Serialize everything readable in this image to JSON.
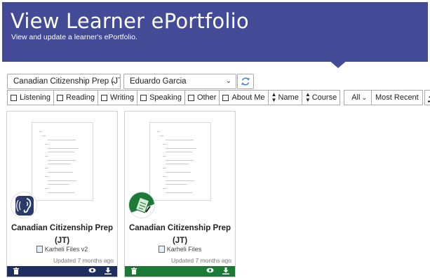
{
  "header": {
    "title": "View Learner ePortfolio",
    "subtitle": "View and update a learner's ePortfolio.",
    "bg_color": "#434b96"
  },
  "selectors": {
    "course": "Canadian Citizenship Prep (JT",
    "learner": "Eduardo Garcia",
    "refresh_icon": "refresh-icon"
  },
  "filters": {
    "skills": [
      "Listening",
      "Reading",
      "Writing",
      "Speaking",
      "Other",
      "About Me"
    ],
    "sort_name": "Name",
    "sort_course": "Course",
    "type_select": "All",
    "order": "Most Recent",
    "upload_icon": "upload-icon"
  },
  "cards": [
    {
      "title": "Canadian Citizenship Prep (JT)",
      "files": "Karheli Files v2",
      "updated": "Updated 7 months ago",
      "bar_color": "#1e2e5e",
      "avatar": "listening-ear-icon"
    },
    {
      "title": "Canadian Citizenship Prep (JT)",
      "files": "Karheli Files",
      "updated": "Updated 7 months ago",
      "bar_color": "#1c7a37",
      "avatar": "document-pen-icon"
    }
  ]
}
